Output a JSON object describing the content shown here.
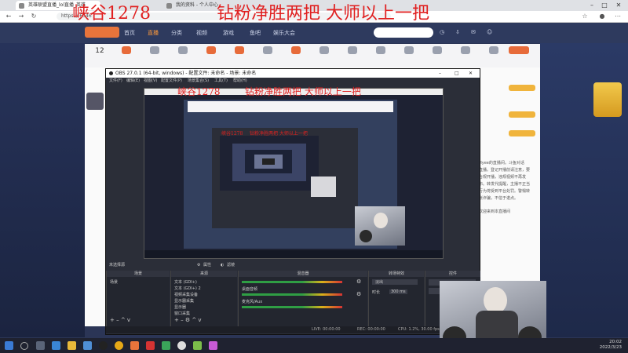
{
  "overlay": {
    "left_text": "峡谷1278",
    "right_text": "钻粉净胜两把 大师以上一把"
  },
  "browser": {
    "tabs": [
      "英雄联盟直播_lol直播_英雄",
      "我的资料 - 个人中心",
      "英雄联盟"
    ],
    "url": "https://                                          6546"
  },
  "site": {
    "nav": [
      "首页",
      "直播",
      "分类",
      "视频",
      "游戏",
      "鱼吧",
      "娱乐大会"
    ],
    "follow_count": "12",
    "categories": [
      "",
      "",
      "",
      "",
      "",
      "",
      "",
      "",
      "",
      "",
      "",
      "",
      "",
      "",
      "",
      ""
    ],
    "side_lines": [
      "Hyee的直播间。斗鱼对话",
      "直播。登记开播前请注意，要",
      "合规开播，违规视频不再发",
      "布。转发代提醒，主播不正当",
      "行为将受到平台处罚。警惕转",
      "账诈骗，不信于诺点。",
      "欢迎来到本直播间"
    ]
  },
  "obs": {
    "title": "OBS 27.0.1 (64-bit, windows) - 配置文件: 未命名 - 场景: 未命名",
    "menu": [
      "文件(F)",
      "编辑(E)",
      "视图(V)",
      "配置文件(P)",
      "场景集合(S)",
      "工具(T)",
      "帮助(H)"
    ],
    "status_line": "未选择源",
    "props_label": "属性",
    "filters_label": "滤镜",
    "docks": {
      "scenes": {
        "title": "场景",
        "items": [
          "场景"
        ]
      },
      "sources": {
        "title": "来源",
        "items": [
          "文本 (GDI+)",
          "文本 (GDI+) 2",
          "视频采集设备",
          "显示器采集",
          "显示器",
          "窗口采集"
        ]
      },
      "mixer": {
        "title": "混音器",
        "channels": [
          "桌面音频",
          "麦克风/Aux"
        ]
      },
      "transitions": {
        "title": "转场特效",
        "type": "淡出",
        "duration_label": "时长",
        "duration": "300 ms"
      },
      "controls": {
        "title": "控件"
      }
    },
    "status_bar": {
      "live": "LIVE: 00:00:00",
      "rec": "REC: 00:00:00",
      "cpu": "CPU: 1.2%, 30.00 fps"
    }
  },
  "taskbar": {
    "time": "20:02",
    "date": "2022/3/23"
  },
  "colors": {
    "overlay_text": "#e02020",
    "site_nav": "#2e3a5e",
    "obs_bg": "#2b2e38"
  }
}
